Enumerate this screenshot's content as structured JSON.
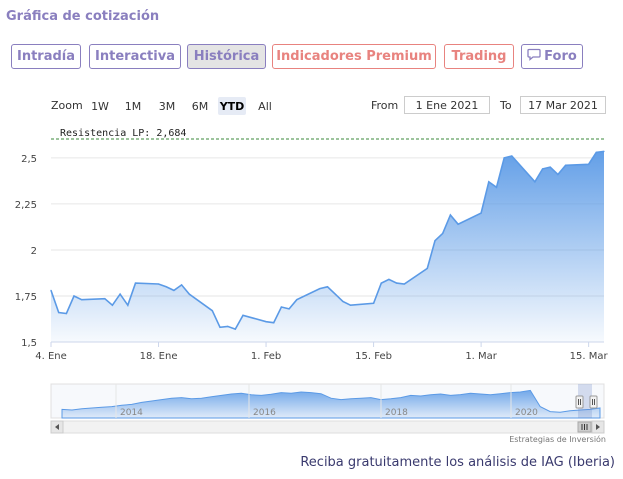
{
  "header": {
    "title": "Gráfica de cotización"
  },
  "tabs": [
    {
      "label": "Intradía",
      "active": false,
      "style": "normal"
    },
    {
      "label": "Interactiva",
      "active": false,
      "style": "normal"
    },
    {
      "label": "Histórica",
      "active": true,
      "style": "normal"
    },
    {
      "label": "Indicadores Premium",
      "active": false,
      "style": "premium"
    },
    {
      "label": "Trading",
      "active": false,
      "style": "premium"
    },
    {
      "label": "Foro",
      "active": false,
      "style": "normal",
      "icon": "speech-bubble-icon"
    }
  ],
  "controls": {
    "zoom_label": "Zoom",
    "ranges": [
      "1W",
      "1M",
      "3M",
      "6M",
      "YTD",
      "All"
    ],
    "selected_range": "YTD",
    "from_label": "From",
    "from_value": "1 Ene 2021",
    "to_label": "To",
    "to_value": "17 Mar 2021"
  },
  "colors": {
    "accent": "#8a7fbf",
    "premium": "#e8837f",
    "series": "#5b9ae6",
    "resistance": "#3b8a3b"
  },
  "chart_data": {
    "type": "area",
    "resistance": {
      "label": "Resistencia LP: 2,684",
      "value": 2.684
    },
    "ylim": [
      1.5,
      2.57
    ],
    "yticks": [
      {
        "value": 1.5,
        "label": "1,5"
      },
      {
        "value": 1.75,
        "label": "1,75"
      },
      {
        "value": 2.0,
        "label": "2"
      },
      {
        "value": 2.25,
        "label": "2,25"
      },
      {
        "value": 2.5,
        "label": "2,5"
      }
    ],
    "xlim": [
      "2021-01-04",
      "2021-03-17"
    ],
    "xticks": [
      {
        "date": "2021-01-04",
        "label": "4. Ene"
      },
      {
        "date": "2021-01-18",
        "label": "18. Ene"
      },
      {
        "date": "2021-02-01",
        "label": "1. Feb"
      },
      {
        "date": "2021-02-15",
        "label": "15. Feb"
      },
      {
        "date": "2021-03-01",
        "label": "1. Mar"
      },
      {
        "date": "2021-03-15",
        "label": "15. Mar"
      }
    ],
    "x": [
      "2021-01-04",
      "2021-01-05",
      "2021-01-06",
      "2021-01-07",
      "2021-01-08",
      "2021-01-11",
      "2021-01-12",
      "2021-01-13",
      "2021-01-14",
      "2021-01-15",
      "2021-01-18",
      "2021-01-19",
      "2021-01-20",
      "2021-01-21",
      "2021-01-22",
      "2021-01-25",
      "2021-01-26",
      "2021-01-27",
      "2021-01-28",
      "2021-01-29",
      "2021-02-01",
      "2021-02-02",
      "2021-02-03",
      "2021-02-04",
      "2021-02-05",
      "2021-02-08",
      "2021-02-09",
      "2021-02-10",
      "2021-02-11",
      "2021-02-12",
      "2021-02-15",
      "2021-02-16",
      "2021-02-17",
      "2021-02-18",
      "2021-02-19",
      "2021-02-22",
      "2021-02-23",
      "2021-02-24",
      "2021-02-25",
      "2021-02-26",
      "2021-03-01",
      "2021-03-02",
      "2021-03-03",
      "2021-03-04",
      "2021-03-05",
      "2021-03-08",
      "2021-03-09",
      "2021-03-10",
      "2021-03-11",
      "2021-03-12",
      "2021-03-15",
      "2021-03-16",
      "2021-03-17"
    ],
    "series": [
      {
        "values": [
          1.78,
          1.66,
          1.655,
          1.75,
          1.73,
          1.735,
          1.7,
          1.76,
          1.7,
          1.82,
          1.815,
          1.8,
          1.78,
          1.81,
          1.76,
          1.67,
          1.58,
          1.585,
          1.57,
          1.645,
          1.61,
          1.605,
          1.69,
          1.68,
          1.73,
          1.79,
          1.8,
          1.76,
          1.72,
          1.7,
          1.71,
          1.82,
          1.84,
          1.82,
          1.815,
          1.9,
          2.05,
          2.09,
          2.19,
          2.14,
          2.2,
          2.37,
          2.34,
          2.5,
          2.51,
          2.37,
          2.44,
          2.45,
          2.41,
          2.46,
          2.465,
          2.53,
          2.535
        ]
      }
    ]
  },
  "navigator": {
    "year_labels": [
      "2014",
      "2016",
      "2018",
      "2020"
    ]
  },
  "credits": "Estrategias de Inversión",
  "footer": {
    "link_text": "Reciba gratuitamente los análisis de IAG (Iberia)"
  }
}
